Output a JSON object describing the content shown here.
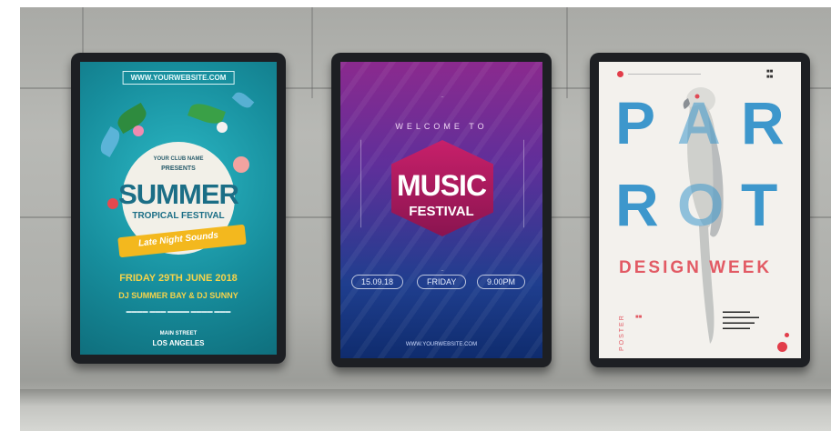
{
  "poster1": {
    "url": "WWW.YOURWEBSITE.COM",
    "club": "YOUR CLUB NAME",
    "presents": "PRESENTS",
    "title": "SUMMER",
    "subtitle": "TROPICAL FESTIVAL",
    "ribbon": "Late Night Sounds",
    "date": "FRIDAY 29TH JUNE 2018",
    "djs": "DJ SUMMER BAY & DJ SUNNY",
    "street": "MAIN STREET",
    "city": "LOS ANGELES"
  },
  "poster2": {
    "welcome": "WELCOME TO",
    "title": "MUSIC",
    "subtitle": "FESTIVAL",
    "date": "15.09.18",
    "day": "FRIDAY",
    "time": "9.00PM",
    "url": "WWW.YOURWEBSITE.COM"
  },
  "poster3": {
    "letters": [
      "P",
      "A",
      "R",
      "R",
      "O",
      "T"
    ],
    "tagline": "DESIGN WEEK",
    "side": "POSTER"
  },
  "colors": {
    "wall": "#b1b2ae",
    "frame": "#1d1f23",
    "teal": "#178e9d",
    "magenta": "#c8206a",
    "blue": "#3d97cc",
    "red": "#e25a64"
  }
}
